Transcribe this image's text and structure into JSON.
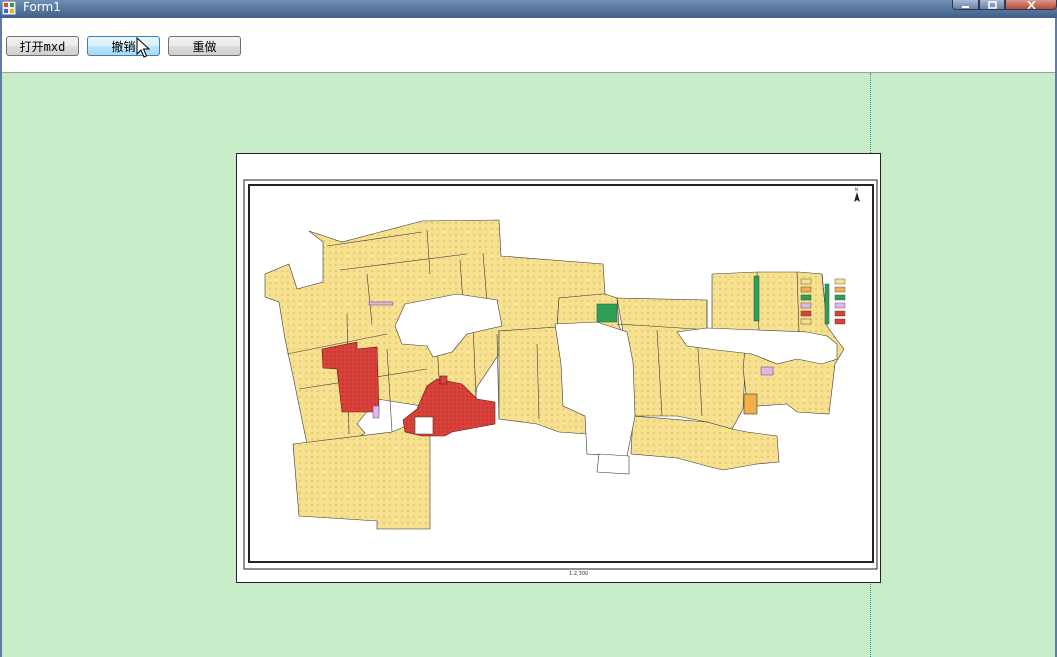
{
  "window": {
    "title": "Form1",
    "controls": [
      "minimize",
      "maximize",
      "close"
    ]
  },
  "toolbar": {
    "open_label": "打开mxd",
    "undo_label": "撤销",
    "redo_label": "重做"
  },
  "map": {
    "scale_text": "1:2,300",
    "colors": {
      "background": "#c8ecc8",
      "parcel": "#f7e08e",
      "highlight_red": "#d9423a",
      "green": "#2f9e57",
      "road": "#ffffff"
    }
  }
}
